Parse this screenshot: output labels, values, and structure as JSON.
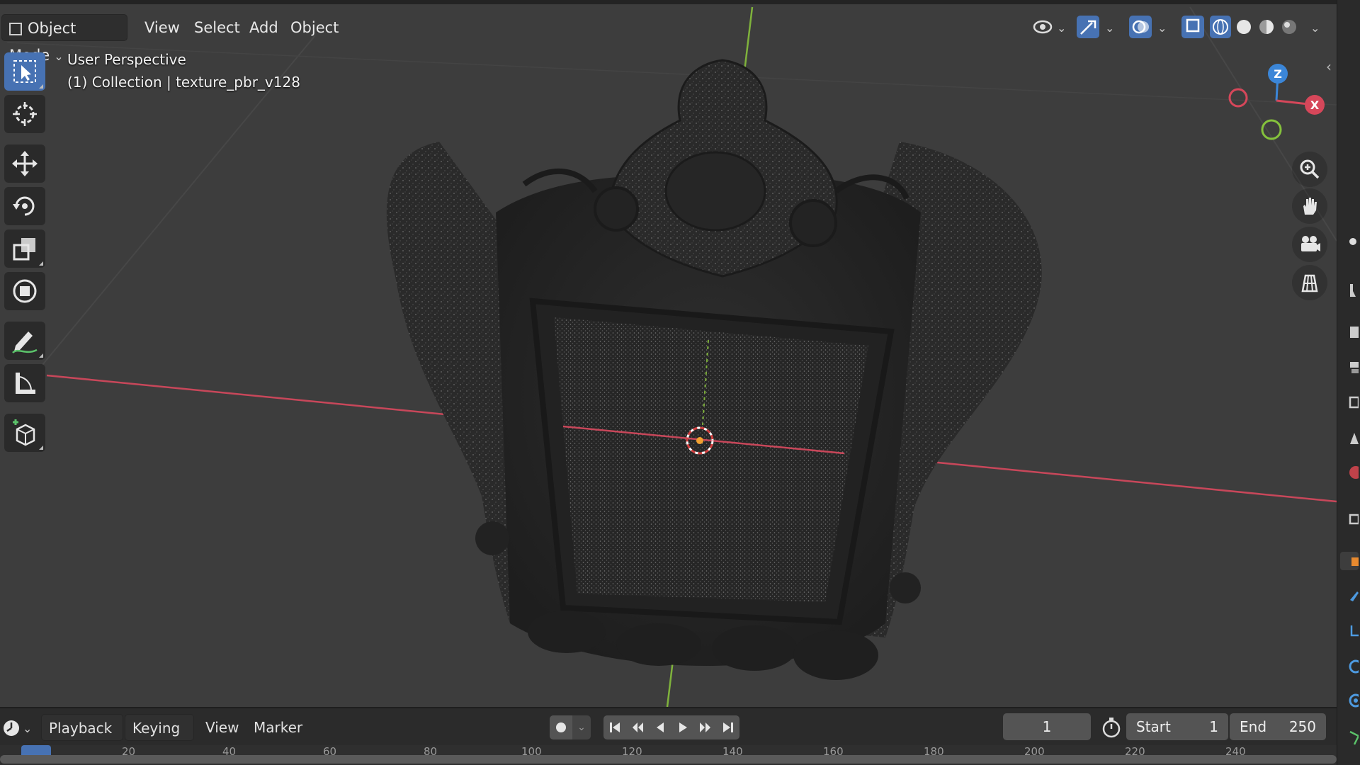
{
  "header": {
    "mode_label": "Object Mode",
    "menus": [
      "View",
      "Select",
      "Add",
      "Object"
    ]
  },
  "viewport": {
    "overlay_title": "User Perspective",
    "overlay_subtitle": "(1) Collection | texture_pbr_v128",
    "gizmo": {
      "x_label": "X",
      "y_label": "",
      "z_label": "Z"
    }
  },
  "toolbar": {
    "tools": [
      {
        "name": "select-box",
        "icon": "cursor-arrow-icon",
        "active": true
      },
      {
        "name": "cursor",
        "icon": "3d-cursor-icon",
        "active": false
      },
      {
        "name": "move",
        "icon": "move-arrows-icon",
        "active": false
      },
      {
        "name": "rotate",
        "icon": "rotate-icon",
        "active": false
      },
      {
        "name": "scale",
        "icon": "scale-icon",
        "active": false
      },
      {
        "name": "transform",
        "icon": "transform-icon",
        "active": false
      },
      {
        "name": "annotate",
        "icon": "pencil-icon",
        "active": false
      },
      {
        "name": "measure",
        "icon": "ruler-icon",
        "active": false
      },
      {
        "name": "add-cube",
        "icon": "add-cube-icon",
        "active": false
      }
    ]
  },
  "timeline": {
    "menus": [
      "Playback",
      "Keying",
      "View",
      "Marker"
    ],
    "current_frame": "1",
    "start_label": "Start",
    "start_value": "1",
    "end_label": "End",
    "end_value": "250",
    "ruler_ticks": [
      "20",
      "40",
      "60",
      "80",
      "100",
      "120",
      "140",
      "160",
      "180",
      "200",
      "220",
      "240"
    ]
  },
  "colors": {
    "accent": "#4772b3",
    "x_axis": "#d6475a",
    "y_axis": "#85c23c",
    "z_axis": "#3b86d8"
  }
}
